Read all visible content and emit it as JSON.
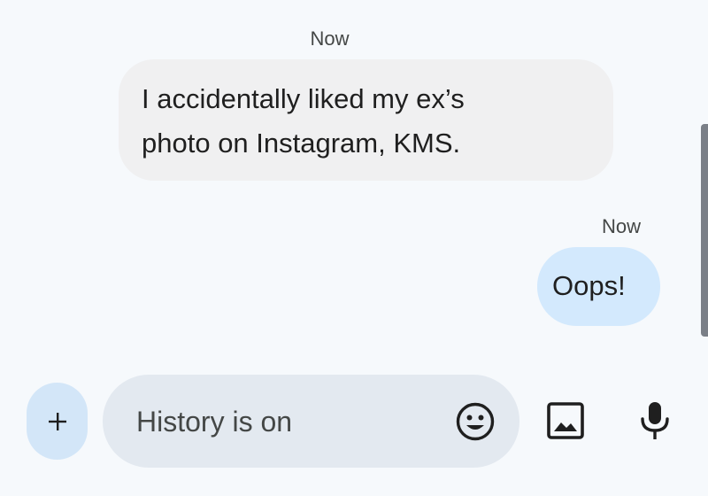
{
  "conversation": {
    "messages": [
      {
        "direction": "received",
        "timestamp": "Now",
        "text_lines": [
          "I accidentally liked my ex’s",
          "photo on Instagram, KMS."
        ]
      },
      {
        "direction": "sent",
        "timestamp": "Now",
        "text": "Oops!"
      }
    ]
  },
  "composer": {
    "placeholder": "History is on",
    "value": "",
    "add_icon": "plus-icon",
    "emoji_icon": "emoji-icon",
    "gallery_icon": "gallery-icon",
    "mic_icon": "mic-icon"
  },
  "colors": {
    "background": "#f6f9fc",
    "received_bubble": "#f0f0f1",
    "sent_bubble": "#d3e9fd",
    "compose_bar": "#e3e9f0",
    "add_button": "#d3e6f8",
    "icon": "#1f1f1f"
  }
}
